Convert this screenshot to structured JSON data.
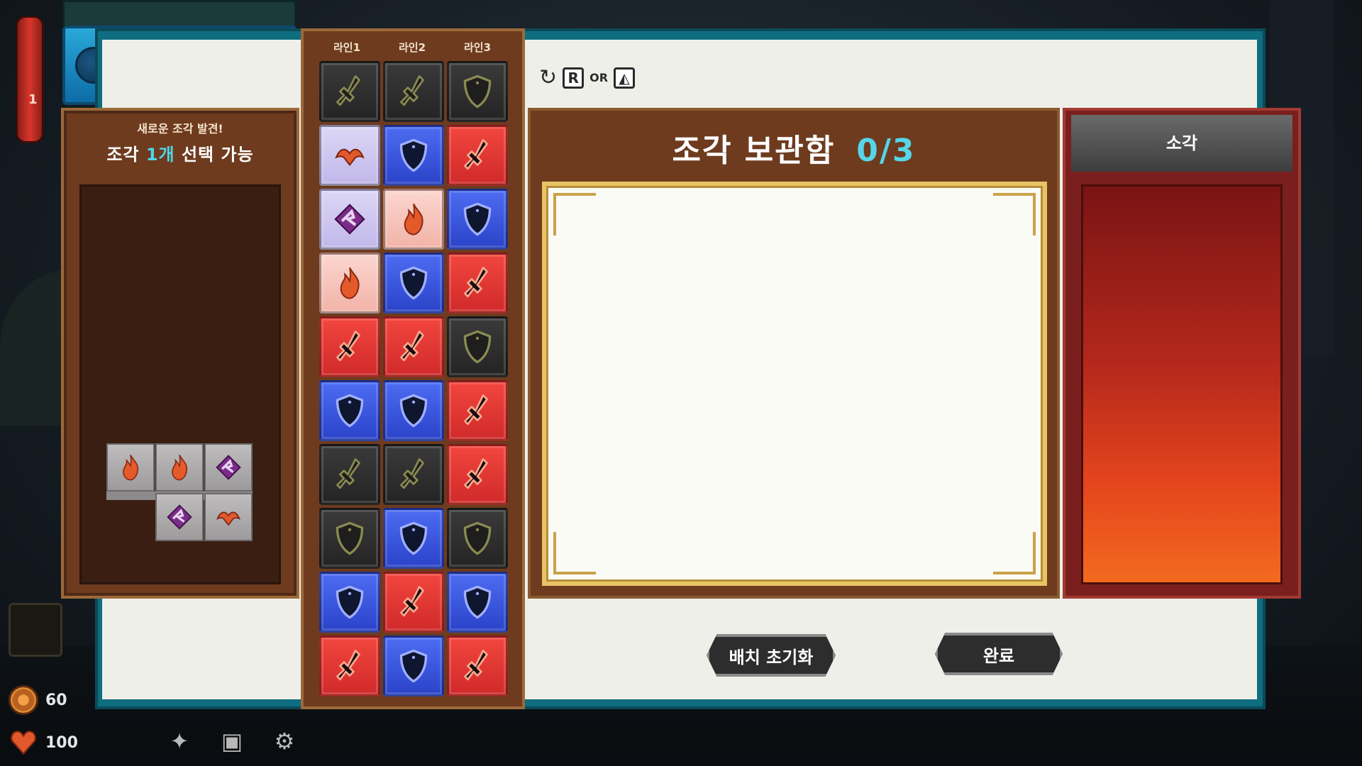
{
  "colors": {
    "accent_cyan": "#4fd6e8",
    "wood": "#6e3b1f",
    "teal_frame": "#0f6d80"
  },
  "energy": {
    "value": "1",
    "orbs": 5
  },
  "discovery": {
    "subtitle": "새로운 조각 발견!",
    "title_pre": "조각 ",
    "title_count": "1개",
    "title_post": " 선택 가능"
  },
  "lines": [
    "라인1",
    "라인2",
    "라인3"
  ],
  "grid": [
    [
      "dark-sword",
      "dark-sword",
      "dark-shield"
    ],
    [
      "lav-bird",
      "blue-shield",
      "red-sword"
    ],
    [
      "lav-claw",
      "pink-flame",
      "blue-shield"
    ],
    [
      "pink-flame",
      "blue-shield",
      "red-sword"
    ],
    [
      "red-sword",
      "red-sword",
      "dark-shield"
    ],
    [
      "blue-shield",
      "blue-shield",
      "red-sword"
    ],
    [
      "dark-sword",
      "dark-sword",
      "red-sword"
    ],
    [
      "dark-shield",
      "blue-shield",
      "dark-shield"
    ],
    [
      "blue-shield",
      "red-sword",
      "blue-shield"
    ],
    [
      "red-sword",
      "blue-shield",
      "red-sword"
    ]
  ],
  "discovered_piece": [
    "flame-icon",
    "flame-icon",
    "claw-icon",
    "claw-icon",
    "bird-icon"
  ],
  "hint": {
    "key": "R",
    "or": "OR"
  },
  "storage": {
    "title": "조각 보관함",
    "count": "0/3"
  },
  "burn": {
    "title": "소각"
  },
  "buttons": {
    "reset": "배치 초기화",
    "done": "완료"
  },
  "resources": {
    "coins": "60",
    "health": "100"
  },
  "hud_icons": [
    "bomb-icon",
    "chest-icon",
    "gear-icon"
  ]
}
